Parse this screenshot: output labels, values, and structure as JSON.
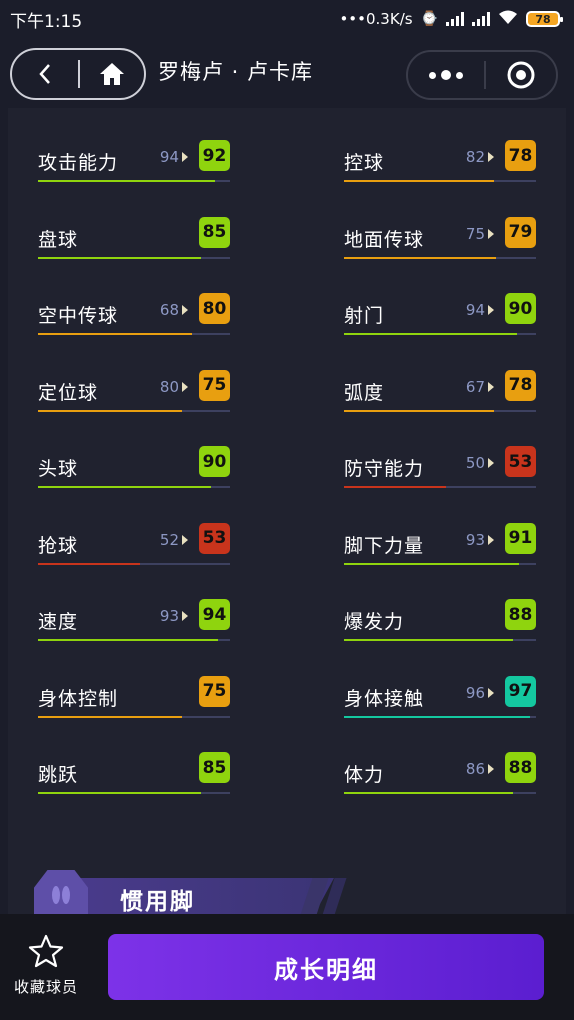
{
  "status_bar": {
    "time": "下午1:15",
    "network_speed": "0.3K/s",
    "battery": "78"
  },
  "nav": {
    "title": "罗梅卢 · 卢卡库"
  },
  "colors": {
    "green": "#8fd40e",
    "orange": "#e89f10",
    "red": "#c8341c",
    "teal": "#14c8a0"
  },
  "attributes": {
    "left": [
      {
        "name": "攻击能力",
        "prev": "94",
        "value": "92",
        "level": "green",
        "fill": 0.92
      },
      {
        "name": "盘球",
        "prev": "",
        "value": "85",
        "level": "green",
        "fill": 0.85
      },
      {
        "name": "空中传球",
        "prev": "68",
        "value": "80",
        "level": "orange",
        "fill": 0.8
      },
      {
        "name": "定位球",
        "prev": "80",
        "value": "75",
        "level": "orange",
        "fill": 0.75
      },
      {
        "name": "头球",
        "prev": "",
        "value": "90",
        "level": "green",
        "fill": 0.9
      },
      {
        "name": "抢球",
        "prev": "52",
        "value": "53",
        "level": "red",
        "fill": 0.53
      },
      {
        "name": "速度",
        "prev": "93",
        "value": "94",
        "level": "green",
        "fill": 0.94
      },
      {
        "name": "身体控制",
        "prev": "",
        "value": "75",
        "level": "orange",
        "fill": 0.75
      },
      {
        "name": "跳跃",
        "prev": "",
        "value": "85",
        "level": "green",
        "fill": 0.85
      }
    ],
    "right": [
      {
        "name": "控球",
        "prev": "82",
        "value": "78",
        "level": "orange",
        "fill": 0.78
      },
      {
        "name": "地面传球",
        "prev": "75",
        "value": "79",
        "level": "orange",
        "fill": 0.79
      },
      {
        "name": "射门",
        "prev": "94",
        "value": "90",
        "level": "green",
        "fill": 0.9
      },
      {
        "name": "弧度",
        "prev": "67",
        "value": "78",
        "level": "orange",
        "fill": 0.78
      },
      {
        "name": "防守能力",
        "prev": "50",
        "value": "53",
        "level": "red",
        "fill": 0.53
      },
      {
        "name": "脚下力量",
        "prev": "93",
        "value": "91",
        "level": "green",
        "fill": 0.91
      },
      {
        "name": "爆发力",
        "prev": "",
        "value": "88",
        "level": "green",
        "fill": 0.88
      },
      {
        "name": "身体接触",
        "prev": "96",
        "value": "97",
        "level": "teal",
        "fill": 0.97
      },
      {
        "name": "体力",
        "prev": "86",
        "value": "88",
        "level": "green",
        "fill": 0.88
      }
    ]
  },
  "section": {
    "preferred_foot_label": "惯用脚"
  },
  "bottom": {
    "favorite_label": "收藏球员",
    "growth_button_label": "成长明细"
  }
}
